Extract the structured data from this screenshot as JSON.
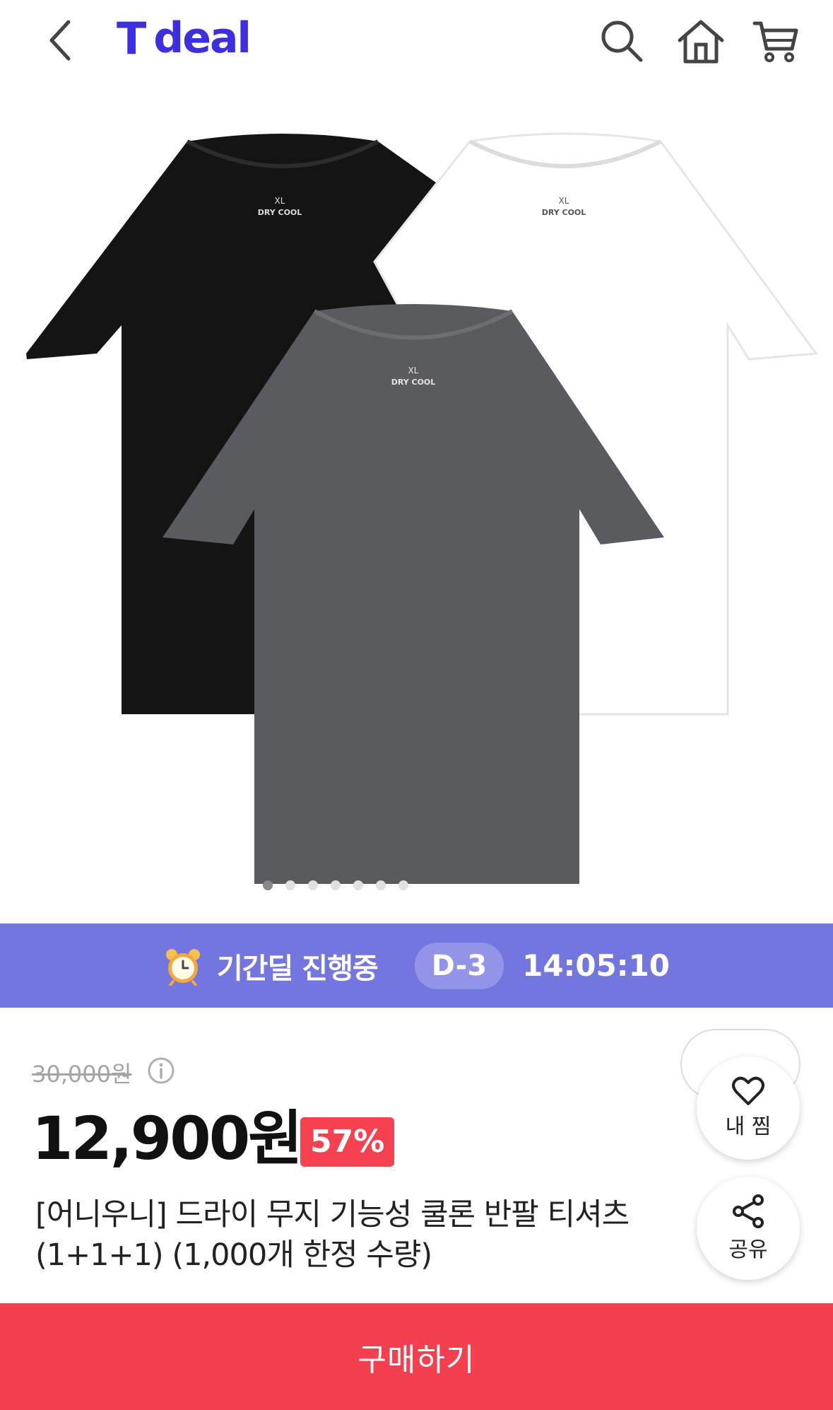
{
  "header": {
    "logo_t": "T",
    "logo_text": "deal",
    "brand_color": "#3d2ee0",
    "icons": [
      "back-icon",
      "search-icon",
      "home-icon",
      "cart-icon"
    ]
  },
  "gallery": {
    "tag_size": "XL",
    "tag_brand": "DRY COOL",
    "slide_count": 7,
    "active_slide": 1
  },
  "timer": {
    "label": "기간딜 진행중",
    "dday": "D-3",
    "countdown": "14:05:10",
    "bg_color": "#7476e0"
  },
  "price": {
    "original": "30,000원",
    "sale": "12,900원",
    "discount": "57%",
    "discount_color": "#f54150"
  },
  "product": {
    "title": "[어니우니] 드라이 무지 기능성 쿨론 반팔 티셔츠 (1+1+1) (1,000개 한정 수량)"
  },
  "actions": {
    "wish_label": "내 찜",
    "share_label": "공유",
    "buy_label": "구매하기",
    "buy_color": "#f43f4f"
  }
}
